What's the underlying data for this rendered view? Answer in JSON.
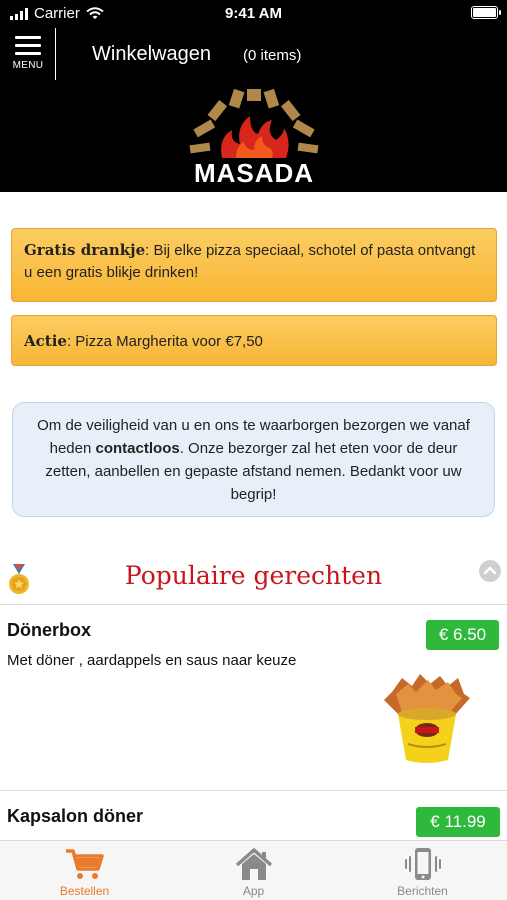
{
  "status_bar": {
    "carrier": "Carrier",
    "time": "9:41 AM"
  },
  "header": {
    "menu_label": "MENU",
    "title": "Winkelwagen",
    "cart_count": "(0 items)",
    "logo_text": "MASADA"
  },
  "promos": [
    {
      "bold": "Gratis drankje",
      "text": ": Bij elke pizza speciaal, schotel of pasta ontvangt u een gratis blikje drinken!"
    },
    {
      "bold": "Actie",
      "text": ": Pizza Margherita voor €7,50"
    }
  ],
  "notice": {
    "before": "Om de veiligheid van u en ons te waarborgen bezorgen we vanaf heden ",
    "bold": "contactloos",
    "after": ". Onze bezorger zal het eten voor de deur zetten, aanbellen en gepaste afstand nemen. Bedankt voor uw begrip!"
  },
  "section": {
    "title": "Populaire gerechten"
  },
  "items": [
    {
      "name": "Dönerbox",
      "description": "Met döner , aardappels en saus naar keuze",
      "price": "€ 6.50 +"
    },
    {
      "name": "Kapsalon döner",
      "price": "€ 11.99 +"
    }
  ],
  "tabs": [
    {
      "label": "Bestellen",
      "icon": "cart-icon",
      "active": true
    },
    {
      "label": "App",
      "icon": "home-icon",
      "active": false
    },
    {
      "label": "Berichten",
      "icon": "phone-vibrate-icon",
      "active": false
    }
  ],
  "colors": {
    "accent": "#e87b2c",
    "price_green": "#2eb83c",
    "title_red": "#c8161d",
    "promo_yellow": "#f8b535"
  }
}
